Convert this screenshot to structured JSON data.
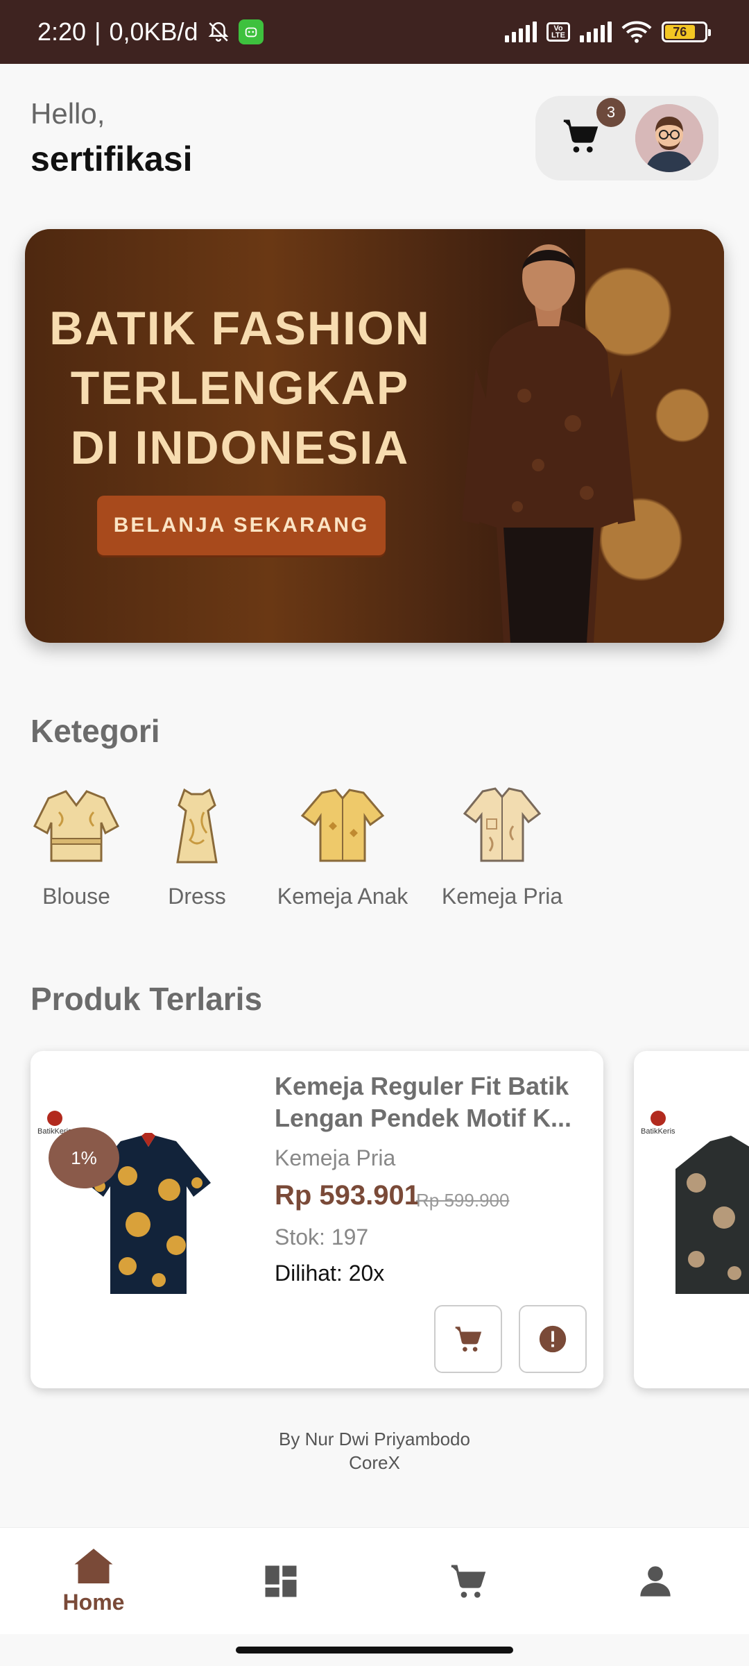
{
  "status_bar": {
    "time": "2:20",
    "net_speed": "0,0KB/d",
    "battery": "76"
  },
  "header": {
    "greeting": "Hello,",
    "username": "sertifikasi",
    "cart_count": "3"
  },
  "banner": {
    "title_lines": [
      "BATIK FASHION",
      "TERLENGKAP",
      "DI INDONESIA"
    ],
    "cta": "BELANJA SEKARANG"
  },
  "categories": {
    "title": "Ketegori",
    "items": [
      {
        "label": "Blouse"
      },
      {
        "label": "Dress"
      },
      {
        "label": "Kemeja Anak"
      },
      {
        "label": "Kemeja Pria"
      }
    ]
  },
  "best_sellers": {
    "title": "Produk Terlaris",
    "products": [
      {
        "name": "Kemeja Reguler Fit Batik Lengan Pendek Motif K...",
        "category": "Kemeja Pria",
        "price": "Rp 593.901",
        "old_price": "Rp 599.900",
        "stock": "Stok: 197",
        "views": "Dilihat: 20x",
        "discount": "1%",
        "brand": "BatikKeris"
      },
      {
        "brand": "BatikKeris"
      }
    ]
  },
  "credits": {
    "line1": "By Nur Dwi Priyambodo",
    "line2": "CoreX"
  },
  "bottom_nav": {
    "items": [
      {
        "label": "Home",
        "icon": "home-icon",
        "active": true
      },
      {
        "label": "",
        "icon": "dashboard-icon"
      },
      {
        "label": "",
        "icon": "cart-icon"
      },
      {
        "label": "",
        "icon": "profile-icon"
      }
    ]
  },
  "colors": {
    "accent": "#7a4a38",
    "status_bar_bg": "#3e2320",
    "banner_button": "#a84a1c"
  }
}
